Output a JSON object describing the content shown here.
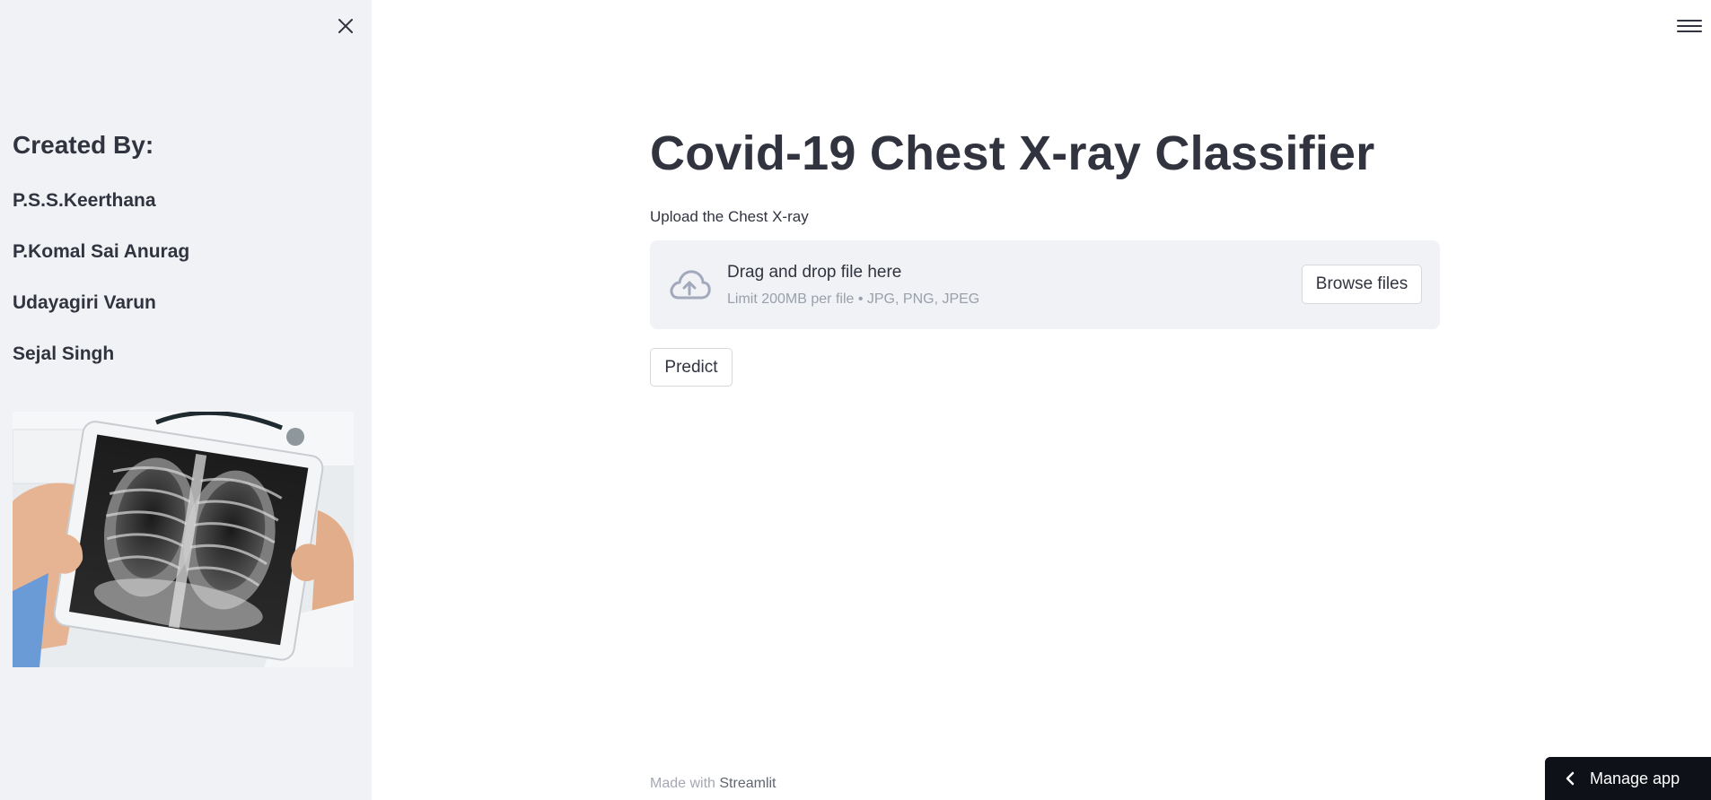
{
  "sidebar": {
    "heading": "Created By:",
    "members": [
      "P.S.S.Keerthana",
      "P.Komal Sai Anurag",
      "Udayagiri Varun",
      "Sejal Singh"
    ]
  },
  "main": {
    "title": "Covid-19 Chest X-ray Classifier",
    "upload_label": "Upload the Chest X-ray",
    "dropzone": {
      "title": "Drag and drop file here",
      "limit": "Limit 200MB per file • JPG, PNG, JPEG",
      "browse_label": "Browse files"
    },
    "predict_label": "Predict"
  },
  "footer": {
    "prefix": "Made with ",
    "brand": "Streamlit"
  },
  "manage_app": {
    "label": "Manage app"
  },
  "icons": {
    "close": "close-icon",
    "menu": "hamburger-menu-icon",
    "upload": "cloud-upload-icon",
    "chevron": "chevron-left-icon"
  },
  "colors": {
    "sidebar_bg": "#f0f2f6",
    "text": "#31333f",
    "dropzone_bg": "#f0f2f6",
    "manage_bg": "#0e1117"
  }
}
